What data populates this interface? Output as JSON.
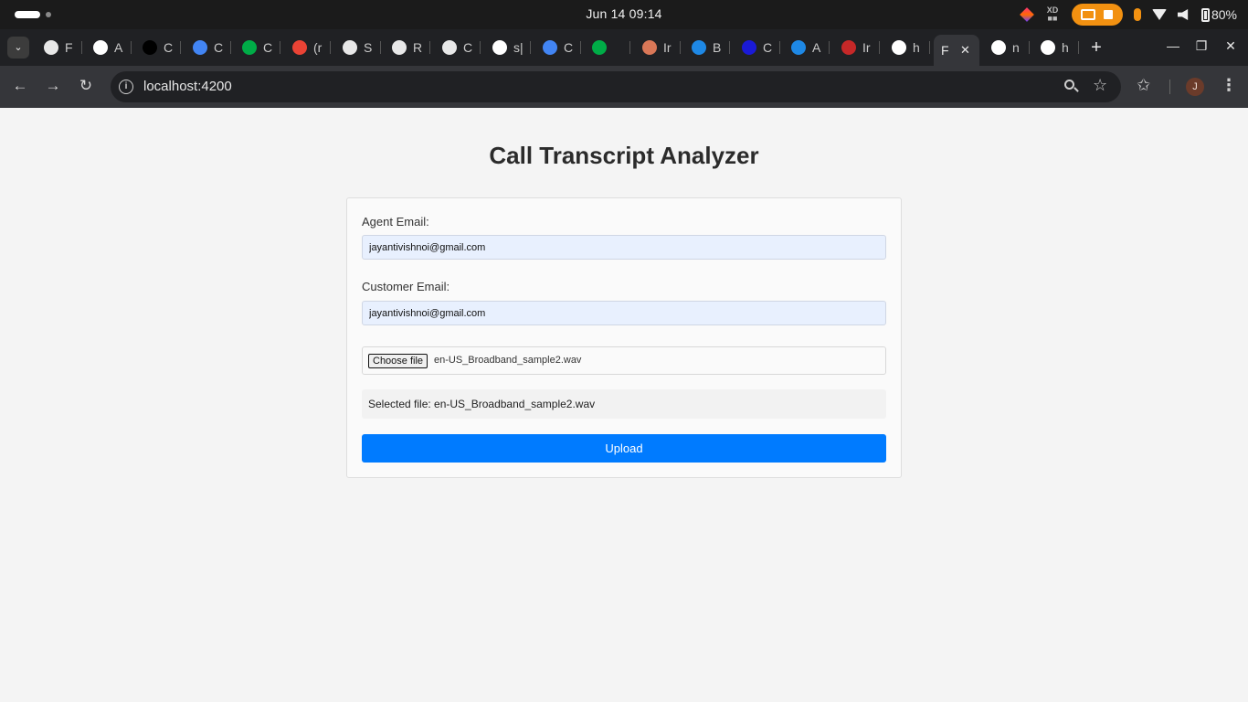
{
  "os": {
    "clock": "Jun 14  09:14",
    "battery": "80%"
  },
  "tabs": [
    {
      "title": "F",
      "icon": "gemini-style-icon",
      "color": "#e8e8e8"
    },
    {
      "title": "A",
      "icon": "pause-app-icon",
      "color": "#ffffff"
    },
    {
      "title": "C",
      "icon": "medium-m-icon",
      "color": "#000000"
    },
    {
      "title": "C",
      "icon": "calendar-14-icon",
      "color": "#4285f4"
    },
    {
      "title": "C",
      "icon": "google-meet-icon",
      "color": "#00ac47"
    },
    {
      "title": "(r",
      "icon": "gmail-m-icon",
      "color": "#ea4335"
    },
    {
      "title": "S",
      "icon": "gemini-style-icon",
      "color": "#e8e8e8"
    },
    {
      "title": "R",
      "icon": "gemini-style-icon",
      "color": "#e8e8e8"
    },
    {
      "title": "C",
      "icon": "gemini-style-icon",
      "color": "#e8e8e8"
    },
    {
      "title": "s|",
      "icon": "github-icon",
      "color": "#ffffff"
    },
    {
      "title": "C",
      "icon": "calendar-14-icon",
      "color": "#4285f4"
    },
    {
      "title": "",
      "icon": "meet-recording-icon",
      "color": "#00ac47"
    },
    {
      "title": "Ir",
      "icon": "claude-asterisk-icon",
      "color": "#d97757"
    },
    {
      "title": "B",
      "icon": "react-atom-icon",
      "color": "#1e88e5"
    },
    {
      "title": "C",
      "icon": "react-atom-icon",
      "color": "#1a1ad6"
    },
    {
      "title": "A",
      "icon": "react-atom-icon",
      "color": "#1e88e5"
    },
    {
      "title": "Ir",
      "icon": "gauge-icon",
      "color": "#c62828"
    },
    {
      "title": "h",
      "icon": "google-g-icon",
      "color": "#ffffff"
    },
    {
      "title": "F",
      "icon": "",
      "color": "#35363a",
      "active": true
    },
    {
      "title": "n",
      "icon": "google-g-icon",
      "color": "#ffffff"
    },
    {
      "title": "h",
      "icon": "github-icon",
      "color": "#ffffff"
    }
  ],
  "toolbar": {
    "url": "localhost:4200",
    "avatar_letter": "J"
  },
  "page": {
    "title": "Call Transcript Analyzer",
    "agent_email_label": "Agent Email:",
    "agent_email_value": "jayantivishnoi@gmail.com",
    "customer_email_label": "Customer Email:",
    "customer_email_value": "jayantivishnoi@gmail.com",
    "choose_file_label": "Choose file",
    "file_name": "en-US_Broadband_sample2.wav",
    "selected_file_text": "Selected file: en-US_Broadband_sample2.wav",
    "upload_label": "Upload"
  },
  "colors": {
    "primary": "#007bff",
    "autofill_bg": "#e8f0fe",
    "chrome_dark": "#202124"
  }
}
